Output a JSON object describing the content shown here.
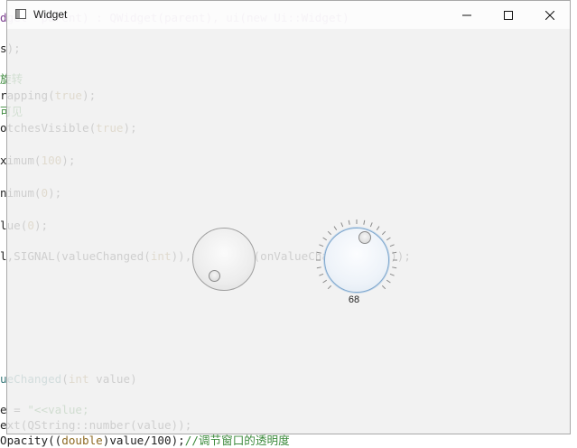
{
  "window": {
    "title": "Widget"
  },
  "code_lines": [
    {
      "segments": [
        [
          "tp",
          "dget *parent) : QWidget(parent), ui(new Ui::Widget)"
        ]
      ]
    },
    {
      "segments": [
        [
          "pl",
          "s);"
        ]
      ]
    },
    {
      "segments": [
        [
          "cm",
          "旋转"
        ]
      ]
    },
    {
      "segments": [
        [
          "pl",
          "rapping("
        ],
        [
          "kw",
          "true"
        ],
        [
          "pl",
          ");"
        ]
      ]
    },
    {
      "segments": [
        [
          "cm",
          "可见"
        ]
      ]
    },
    {
      "segments": [
        [
          "pl",
          "otchesVisible("
        ],
        [
          "kw",
          "true"
        ],
        [
          "pl",
          ");"
        ]
      ]
    },
    {
      "segments": [
        [
          "pl",
          "ximum("
        ],
        [
          "kw",
          "100"
        ],
        [
          "pl",
          ");"
        ]
      ]
    },
    {
      "segments": [
        [
          "pl",
          "nimum("
        ],
        [
          "kw",
          "0"
        ],
        [
          "pl",
          ");"
        ]
      ]
    },
    {
      "segments": [
        [
          "pl",
          "lue("
        ],
        [
          "kw",
          "0"
        ],
        [
          "pl",
          ");"
        ]
      ]
    },
    {
      "segments": [
        [
          "pl",
          "l,SIGNAL(valueChanged("
        ],
        [
          "kw",
          "int"
        ],
        [
          "pl",
          ")),this,SLOT(onValueChanged("
        ],
        [
          "kw",
          "int"
        ],
        [
          "pl",
          ")));"
        ]
      ]
    },
    {
      "segments": [
        [
          "fn",
          "ueChanged"
        ],
        [
          "pl",
          "("
        ],
        [
          "kw",
          "int"
        ],
        [
          "pl",
          " value)"
        ]
      ]
    },
    {
      "segments": [
        [
          "pl",
          "e = "
        ],
        [
          "str",
          "\"<<value;"
        ]
      ]
    },
    {
      "segments": [
        [
          "pl",
          "ext(QString::number(value));"
        ]
      ]
    },
    {
      "segments": [
        [
          "pl",
          "Opacity(("
        ],
        [
          "kw",
          "double"
        ],
        [
          "pl",
          ")value/100);"
        ],
        [
          "cm",
          "//调节窗口的透明度"
        ]
      ]
    }
  ],
  "dials": {
    "plain": {
      "value": 0,
      "min": 0,
      "max": 100
    },
    "notched": {
      "value": 68,
      "min": 0,
      "max": 100,
      "value_label": "68"
    }
  },
  "colors": {
    "window_bg": "#f0f0f0",
    "dial_focus_border": "#7ea7cd"
  },
  "icons": {
    "minimize": "minimize-icon",
    "maximize": "maximize-icon",
    "close": "close-icon",
    "app": "widget-app-icon"
  }
}
